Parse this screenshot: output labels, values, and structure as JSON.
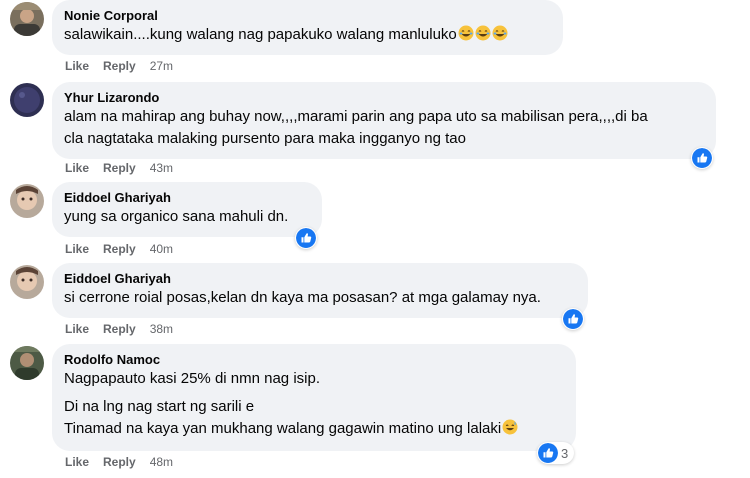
{
  "comments": [
    {
      "author": "Nonie Corporal",
      "lines": [
        "salawikain....kung walang nag papakuko walang manluluko"
      ],
      "emoji_icons": [
        "joy-emoji-icon",
        "joy-emoji-icon",
        "joy-emoji-icon"
      ],
      "like_label": "Like",
      "reply_label": "Reply",
      "time": "27m"
    },
    {
      "author": "Yhur Lizarondo",
      "lines": [
        "alam na mahirap ang buhay now,,,,marami parin ang papa uto sa mabilisan pera,,,,di ba",
        "cla nagtataka malaking pursento para maka ingganyo ng tao"
      ],
      "like_label": "Like",
      "reply_label": "Reply",
      "time": "43m",
      "reaction_icon": "like-reaction-icon"
    },
    {
      "author": "Eiddoel Ghariyah",
      "lines": [
        "yung sa organico sana mahuli dn."
      ],
      "like_label": "Like",
      "reply_label": "Reply",
      "time": "40m",
      "reaction_icon": "like-reaction-icon"
    },
    {
      "author": "Eiddoel Ghariyah",
      "lines": [
        "si cerrone roial posas,kelan dn kaya ma posasan? at mga galamay nya."
      ],
      "like_label": "Like",
      "reply_label": "Reply",
      "time": "38m",
      "reaction_icon": "like-reaction-icon"
    },
    {
      "author": "Rodolfo Namoc",
      "lines": [
        "Nagpapauto kasi 25% di nmn nag isip.",
        "Di na lng nag start ng sarili e",
        "Tinamad na kaya yan mukhang walang gagawin matino ung lalaki"
      ],
      "emoji_icons": [
        "grinning-sweat-emoji-icon"
      ],
      "like_label": "Like",
      "reply_label": "Reply",
      "time": "48m",
      "reaction_icon": "like-reaction-icon",
      "reaction_count": "3"
    }
  ],
  "colors": {
    "bubble_bg": "#f0f2f5",
    "meta_text": "#65676b",
    "like_blue": "#1877f2",
    "emoji_yellow": "#f7c23b"
  }
}
